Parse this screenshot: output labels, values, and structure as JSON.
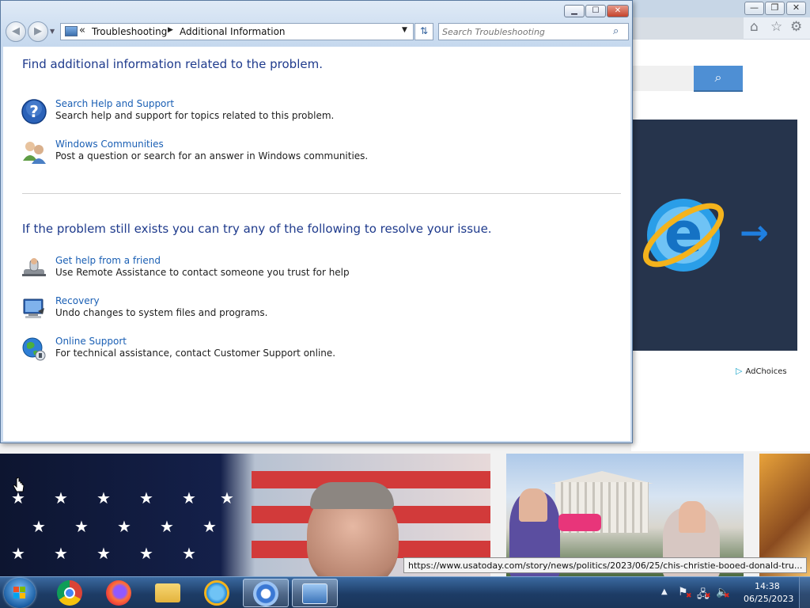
{
  "background_browser": {
    "adchoices_label": "AdChoices",
    "status_url": "https://www.usatoday.com/story/news/politics/2023/06/25/chis-christie-booed-donald-tru..."
  },
  "explorer": {
    "breadcrumb": [
      "Troubleshooting",
      "Additional Information"
    ],
    "search_placeholder": "Search Troubleshooting",
    "section1_heading": "Find additional information related to the problem.",
    "section1_items": [
      {
        "link": "Search Help and Support",
        "desc": "Search help and support for topics related to this problem.",
        "icon": "help-icon"
      },
      {
        "link": "Windows Communities",
        "desc": "Post a question or search for an answer in Windows communities.",
        "icon": "communities-icon"
      }
    ],
    "section2_heading": "If the problem still exists you can try any of the following to resolve your issue.",
    "section2_items": [
      {
        "link": "Get help from a friend",
        "desc": "Use Remote Assistance to contact someone you trust for help",
        "icon": "remote-assistance-icon"
      },
      {
        "link": "Recovery",
        "desc": "Undo changes to system files and programs.",
        "icon": "recovery-icon"
      },
      {
        "link": "Online Support",
        "desc": "For technical assistance, contact Customer Support online.",
        "icon": "online-support-icon"
      }
    ]
  },
  "taskbar": {
    "apps": [
      "chrome-icon",
      "firefox-icon",
      "file-explorer-icon",
      "internet-explorer-icon",
      "chromium-icon",
      "control-panel-icon"
    ],
    "clock_time": "14:38",
    "clock_date": "06/25/2023"
  },
  "colors": {
    "link": "#1a5fb4",
    "heading": "#1e3a8c",
    "taskbar": "#1d3c66"
  }
}
